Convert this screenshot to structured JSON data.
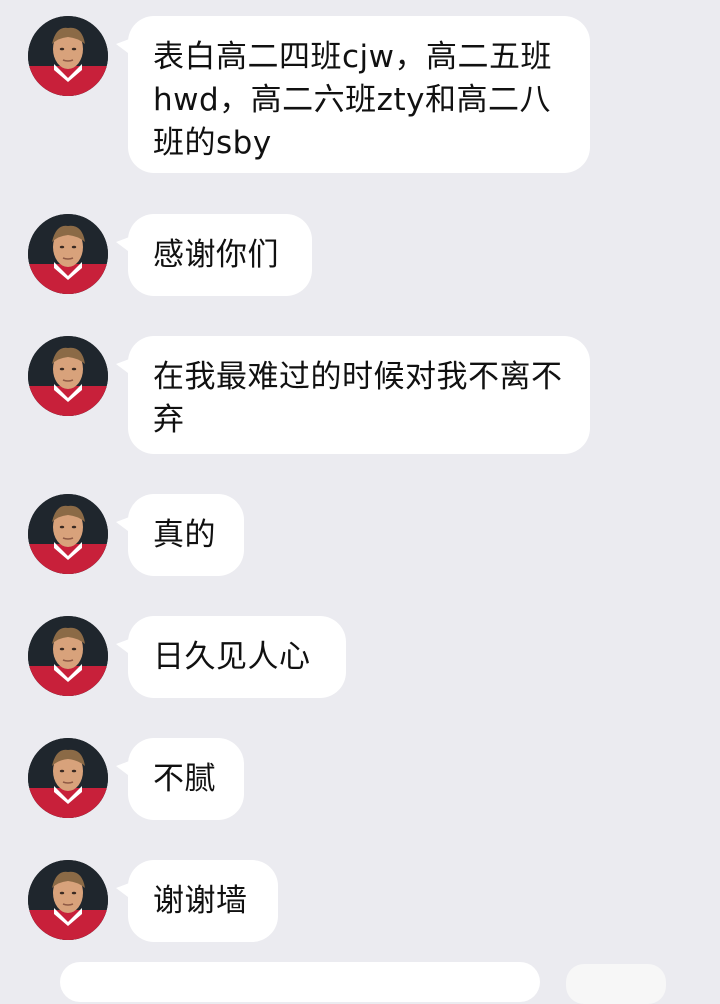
{
  "messages": [
    {
      "text": "表白高二四班cjw，高二五班hwd，高二六班zty和高二八班的sby"
    },
    {
      "text": "感谢你们"
    },
    {
      "text": "在我最难过的时候对我不离不弃"
    },
    {
      "text": "真的"
    },
    {
      "text": "日久见人心"
    },
    {
      "text": "不腻"
    },
    {
      "text": "谢谢墙"
    }
  ],
  "colors": {
    "background": "#ebebf0",
    "bubble": "#ffffff",
    "text": "#111111",
    "avatar_jersey": "#c8203a"
  },
  "icons": {
    "avatar": "user-avatar-icon"
  }
}
